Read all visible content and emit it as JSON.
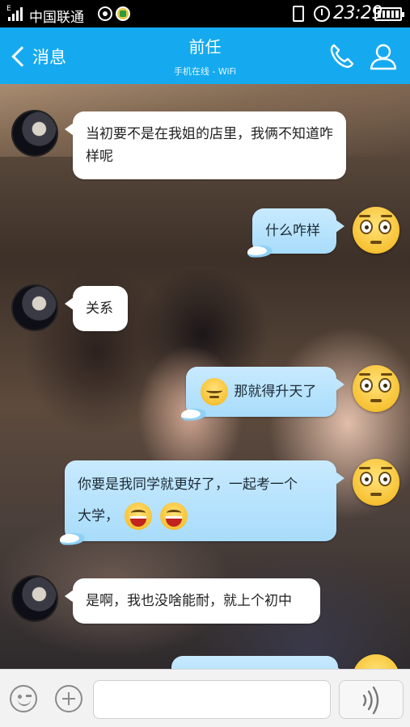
{
  "status_bar": {
    "carrier": "中国联通",
    "network_type": "E",
    "time": "23:29"
  },
  "header": {
    "back_label": "消息",
    "title": "前任",
    "subtitle": "手机在线 - WiFi"
  },
  "messages": [
    {
      "side": "left",
      "text": "当初要不是在我姐的店里，我俩不知道咋样呢"
    },
    {
      "side": "right",
      "text": "什么咋样"
    },
    {
      "side": "left",
      "text": "关系"
    },
    {
      "side": "right",
      "text": "那就得升天了",
      "emoji": "calm"
    },
    {
      "side": "right",
      "text_line1": "你要是我同学就更好了，一起考一个",
      "text_line2": "大学，",
      "emoji": "grin"
    },
    {
      "side": "left",
      "text": "是啊，我也没啥能耐，就上个初中"
    }
  ],
  "input": {
    "placeholder": "",
    "value": ""
  },
  "icons": {
    "back": "chevron-left-icon",
    "phone": "phone-icon",
    "contact": "person-icon",
    "emoji": "smiley-icon",
    "plus": "plus-icon",
    "voice": "voice-wave-icon"
  },
  "colors": {
    "header": "#15aaf0",
    "status_bar": "#000000",
    "bubble_left": "#ffffff",
    "bubble_right": "#bfe6fd",
    "input_bar": "#f2f2f2"
  }
}
